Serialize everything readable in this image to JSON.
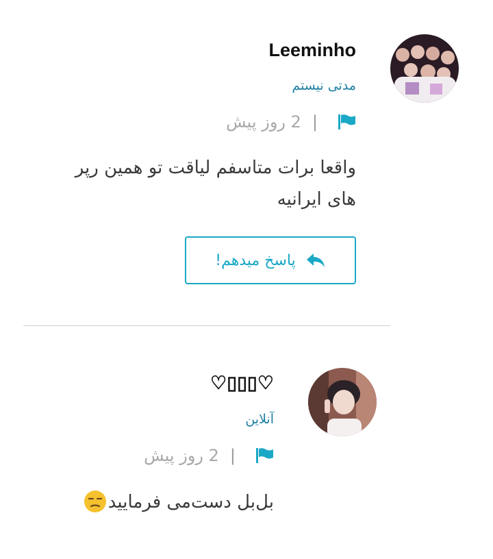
{
  "comments": [
    {
      "username": "Leeminho",
      "status": "مدتی نیستم",
      "time": "2 روز پیش",
      "separator": "|",
      "text": "واقعا برات متاسفم لیاقت تو همین رپر های ایرانیه",
      "reply_label": "پاسخ میدهم!"
    },
    {
      "username": "♡▯▯▯♡",
      "status": "آنلاین",
      "time": "2 روز پیش",
      "separator": "|",
      "text": "بل‌بل دست‌می فرمایید"
    }
  ],
  "colors": {
    "accent": "#1aa8c6",
    "status": "#1f7fa3",
    "meta": "#a8a8a8",
    "divider": "#cfcfcf"
  },
  "icons": {
    "flag": "flag-icon",
    "reply": "reply-arrow-icon",
    "emoji": "unamused-face-emoji"
  }
}
